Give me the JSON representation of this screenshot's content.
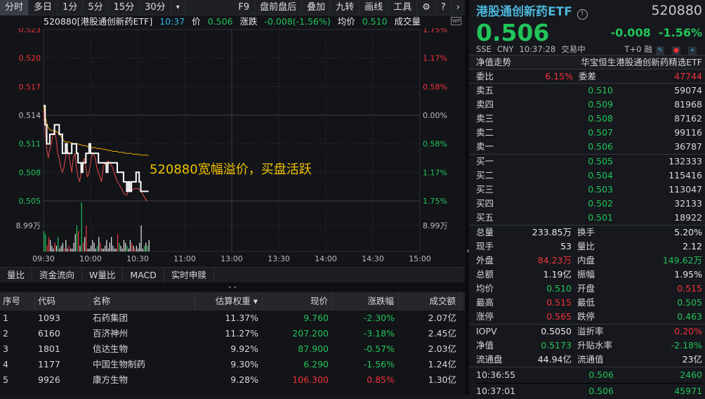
{
  "toolbar": {
    "tabs": [
      "分时",
      "多日",
      "1分",
      "5分",
      "15分",
      "30分"
    ],
    "more": "▾",
    "right": [
      "F9",
      "盘前盘后",
      "叠加",
      "九转",
      "画线",
      "工具"
    ],
    "gear": "⚙",
    "help": "?",
    "next": "›"
  },
  "header": {
    "title": "520880[港股通创新药ETF]",
    "time": "10:37",
    "price_label": "价",
    "price": "0.506",
    "chg_label": "涨跌",
    "chg": "-0.008(-1.56%)",
    "avg_label": "均价",
    "avg": "0.510",
    "vol_label": "成交量",
    "wp": "WP"
  },
  "annotation": "520880宽幅溢价，买盘活跃",
  "chart_data": {
    "type": "line",
    "title": "520880 分时",
    "prev_close": 0.514,
    "ylim": [
      0.505,
      0.523
    ],
    "y_ticks": [
      "0.523",
      "0.520",
      "0.517",
      "0.514",
      "0.511",
      "0.508",
      "0.505"
    ],
    "pct_ticks": [
      "1.75%",
      "1.17%",
      "0.58%",
      "0.00%",
      "0.58%",
      "1.17%",
      "1.75%"
    ],
    "x_ticks": [
      "09:30",
      "10:00",
      "10:30",
      "11:00",
      "13:00",
      "13:30",
      "14:00",
      "14:30",
      "15:00"
    ],
    "vol_tick": "8.99万",
    "price": [
      0.515,
      0.513,
      0.511,
      0.511,
      0.512,
      0.512,
      0.512,
      0.513,
      0.513,
      0.513,
      0.512,
      0.512,
      0.51,
      0.51,
      0.511,
      0.51,
      0.51,
      0.51,
      0.511,
      0.511,
      0.511,
      0.51,
      0.509,
      0.509,
      0.508,
      0.509,
      0.509,
      0.51,
      0.51,
      0.511,
      0.51,
      0.51,
      0.51,
      0.51,
      0.51,
      0.509,
      0.509,
      0.509,
      0.509,
      0.509,
      0.508,
      0.509,
      0.509,
      0.509,
      0.509,
      0.509,
      0.509,
      0.508,
      0.508,
      0.508,
      0.508,
      0.507,
      0.507,
      0.506,
      0.507,
      0.506,
      0.507,
      0.507,
      0.507,
      0.508,
      0.508,
      0.507,
      0.506,
      0.506,
      0.506,
      0.506,
      0.506,
      0.506
    ],
    "nav": [
      0.5145,
      0.5125,
      0.5105,
      0.5095,
      0.5105,
      0.511,
      0.512,
      0.5125,
      0.5115,
      0.51,
      0.5095,
      0.5085,
      0.508,
      0.5085,
      0.5095,
      0.5105,
      0.51,
      0.509,
      0.508,
      0.5095,
      0.51,
      0.5085,
      0.5075,
      0.507,
      0.508,
      0.509,
      0.5095,
      0.5085,
      0.5075,
      0.508,
      0.509,
      0.51,
      0.5098,
      0.5095,
      0.5085,
      0.508,
      0.5075,
      0.507,
      0.5085,
      0.509,
      0.5088,
      0.5092,
      0.509,
      0.5088,
      0.5085,
      0.508,
      0.5075,
      0.507,
      0.5068,
      0.5065,
      0.5062,
      0.5058,
      0.5057,
      0.5056,
      0.506,
      0.5062,
      0.506,
      0.5062,
      0.5063,
      0.5063,
      0.5063,
      0.5062,
      0.506,
      0.5058,
      0.5055,
      0.5052,
      0.505
    ],
    "avg": [
      0.515,
      0.514,
      0.5132,
      0.5127,
      0.5125,
      0.5124,
      0.5124,
      0.5124,
      0.5123,
      0.5122,
      0.512,
      0.5118,
      0.5115,
      0.5113,
      0.5112,
      0.5112,
      0.5112,
      0.5111,
      0.5111,
      0.511,
      0.511,
      0.511,
      0.511,
      0.5109,
      0.5109,
      0.5108,
      0.5108,
      0.5108,
      0.5107,
      0.5107,
      0.5107,
      0.5106,
      0.5106,
      0.5106,
      0.5105,
      0.5105,
      0.5105,
      0.5105,
      0.5104,
      0.5104,
      0.5104,
      0.5103,
      0.5103,
      0.5103,
      0.5102,
      0.5102,
      0.5102,
      0.5102,
      0.5101,
      0.5101,
      0.5101,
      0.5101,
      0.51,
      0.51,
      0.51,
      0.51,
      0.51,
      0.5099,
      0.5099,
      0.5099,
      0.5099,
      0.5099,
      0.5098,
      0.5098,
      0.5098,
      0.5098,
      0.5098,
      0.5098
    ],
    "volume_wan": [
      7,
      6,
      2,
      5,
      4,
      2,
      1,
      3,
      2,
      5,
      1,
      2,
      3,
      1,
      4,
      1,
      2,
      1,
      1,
      3,
      6,
      9,
      7,
      2,
      17,
      3,
      5,
      9,
      1,
      1,
      2,
      4,
      3,
      1,
      2,
      5,
      3,
      1,
      1,
      2,
      4,
      1,
      3,
      5,
      2,
      1,
      1,
      6,
      3,
      2,
      1,
      4,
      3,
      2,
      1,
      4,
      3,
      2,
      1,
      2,
      1,
      3,
      9,
      1,
      2,
      3,
      2,
      4
    ],
    "volume_dir": [
      "g",
      "g",
      "r",
      "r",
      "w",
      "w",
      "w",
      "r",
      "w",
      "g",
      "w",
      "w",
      "w",
      "r",
      "w",
      "w",
      "r",
      "w",
      "w",
      "w",
      "w",
      "g",
      "r",
      "w",
      "g",
      "r",
      "w",
      "r",
      "w",
      "w",
      "w",
      "w",
      "w",
      "w",
      "g",
      "w",
      "r",
      "w",
      "w",
      "w",
      "w",
      "w",
      "w",
      "w",
      "w",
      "w",
      "w",
      "r",
      "g",
      "w",
      "w",
      "w",
      "w",
      "g",
      "w",
      "w",
      "r",
      "w",
      "r",
      "w",
      "w",
      "w",
      "w",
      "w",
      "g",
      "w",
      "g",
      "w"
    ]
  },
  "bottom_tabs": [
    "量比",
    "资金流向",
    "W量比",
    "MACD",
    "实时申赎"
  ],
  "collapse": "⌄⌄",
  "table": {
    "headers": [
      "序号",
      "代码",
      "名称",
      "估算权重 ▾",
      "现价",
      "涨跌幅",
      "成交额"
    ],
    "rows": [
      {
        "no": "1",
        "code": "1093",
        "name": "石药集团",
        "weight": "11.37%",
        "price": "9.760",
        "chg": "-2.30%",
        "amount": "2.07亿",
        "dir": "g"
      },
      {
        "no": "2",
        "code": "6160",
        "name": "百济神州",
        "weight": "11.27%",
        "price": "207.200",
        "chg": "-3.18%",
        "amount": "2.45亿",
        "dir": "g"
      },
      {
        "no": "3",
        "code": "1801",
        "name": "信达生物",
        "weight": "9.92%",
        "price": "87.900",
        "chg": "-0.57%",
        "amount": "2.03亿",
        "dir": "g"
      },
      {
        "no": "4",
        "code": "1177",
        "name": "中国生物制药",
        "weight": "9.30%",
        "price": "6.290",
        "chg": "-1.56%",
        "amount": "1.24亿",
        "dir": "g"
      },
      {
        "no": "5",
        "code": "9926",
        "name": "康方生物",
        "weight": "9.28%",
        "price": "106.300",
        "chg": "0.85%",
        "amount": "1.30亿",
        "dir": "r"
      }
    ]
  },
  "quote": {
    "name": "港股通创新药ETF",
    "info_icon": "!",
    "code": "520880",
    "price": "0.506",
    "chg": "-0.008",
    "pct": "-1.56%",
    "exchange": "SSE",
    "currency": "CNY",
    "time": "10:37:28",
    "status": "交易中",
    "t0": "T+0",
    "margin": "融",
    "nav_trend": "净值走势",
    "full_name": "华宝恒生港股通创新药精选ETF",
    "wb_label": "委比",
    "wb": "6.15%",
    "wc_label": "委差",
    "wc": "47744",
    "asks": [
      {
        "l": "卖五",
        "p": "0.510",
        "v": "59074"
      },
      {
        "l": "卖四",
        "p": "0.509",
        "v": "81968"
      },
      {
        "l": "卖三",
        "p": "0.508",
        "v": "87162"
      },
      {
        "l": "卖二",
        "p": "0.507",
        "v": "99116"
      },
      {
        "l": "卖一",
        "p": "0.506",
        "v": "36787"
      }
    ],
    "bids": [
      {
        "l": "买一",
        "p": "0.505",
        "v": "132333"
      },
      {
        "l": "买二",
        "p": "0.504",
        "v": "115416"
      },
      {
        "l": "买三",
        "p": "0.503",
        "v": "113047"
      },
      {
        "l": "买四",
        "p": "0.502",
        "v": "32133"
      },
      {
        "l": "买五",
        "p": "0.501",
        "v": "18922"
      }
    ],
    "stats": [
      {
        "a": "总量",
        "b": "233.85万",
        "bc": "w",
        "c": "换手",
        "d": "5.20%",
        "dc": "w"
      },
      {
        "a": "现手",
        "b": "53",
        "bc": "w",
        "c": "量比",
        "d": "2.12",
        "dc": "w"
      },
      {
        "a": "外盘",
        "b": "84.23万",
        "bc": "r",
        "c": "内盘",
        "d": "149.62万",
        "dc": "g"
      },
      {
        "a": "总额",
        "b": "1.19亿",
        "bc": "w",
        "c": "振幅",
        "d": "1.95%",
        "dc": "w"
      },
      {
        "a": "均价",
        "b": "0.510",
        "bc": "g",
        "c": "开盘",
        "d": "0.515",
        "dc": "r"
      },
      {
        "a": "最高",
        "b": "0.515",
        "bc": "r",
        "c": "最低",
        "d": "0.505",
        "dc": "g"
      },
      {
        "a": "涨停",
        "b": "0.565",
        "bc": "r",
        "c": "跌停",
        "d": "0.463",
        "dc": "g"
      }
    ],
    "etf": [
      {
        "a": "IOPV",
        "b": "0.5050",
        "bc": "w",
        "c": "溢折率",
        "d": "0.20%",
        "dc": "r"
      },
      {
        "a": "净值",
        "b": "0.5173",
        "bc": "g",
        "c": "升贴水率",
        "d": "-2.18%",
        "dc": "g"
      },
      {
        "a": "流通盘",
        "b": "44.94亿",
        "bc": "w",
        "c": "流通值",
        "d": "23亿",
        "dc": "w"
      }
    ],
    "ticks": [
      {
        "t": "10:36:55",
        "p": "0.506",
        "v": "2460"
      },
      {
        "t": "10:37:01",
        "p": "0.506",
        "v": "45971"
      }
    ]
  },
  "colors": {
    "up": "#f2333b",
    "down": "#22c45a",
    "avg": "#f2a900",
    "nav": "#e84a4a"
  }
}
